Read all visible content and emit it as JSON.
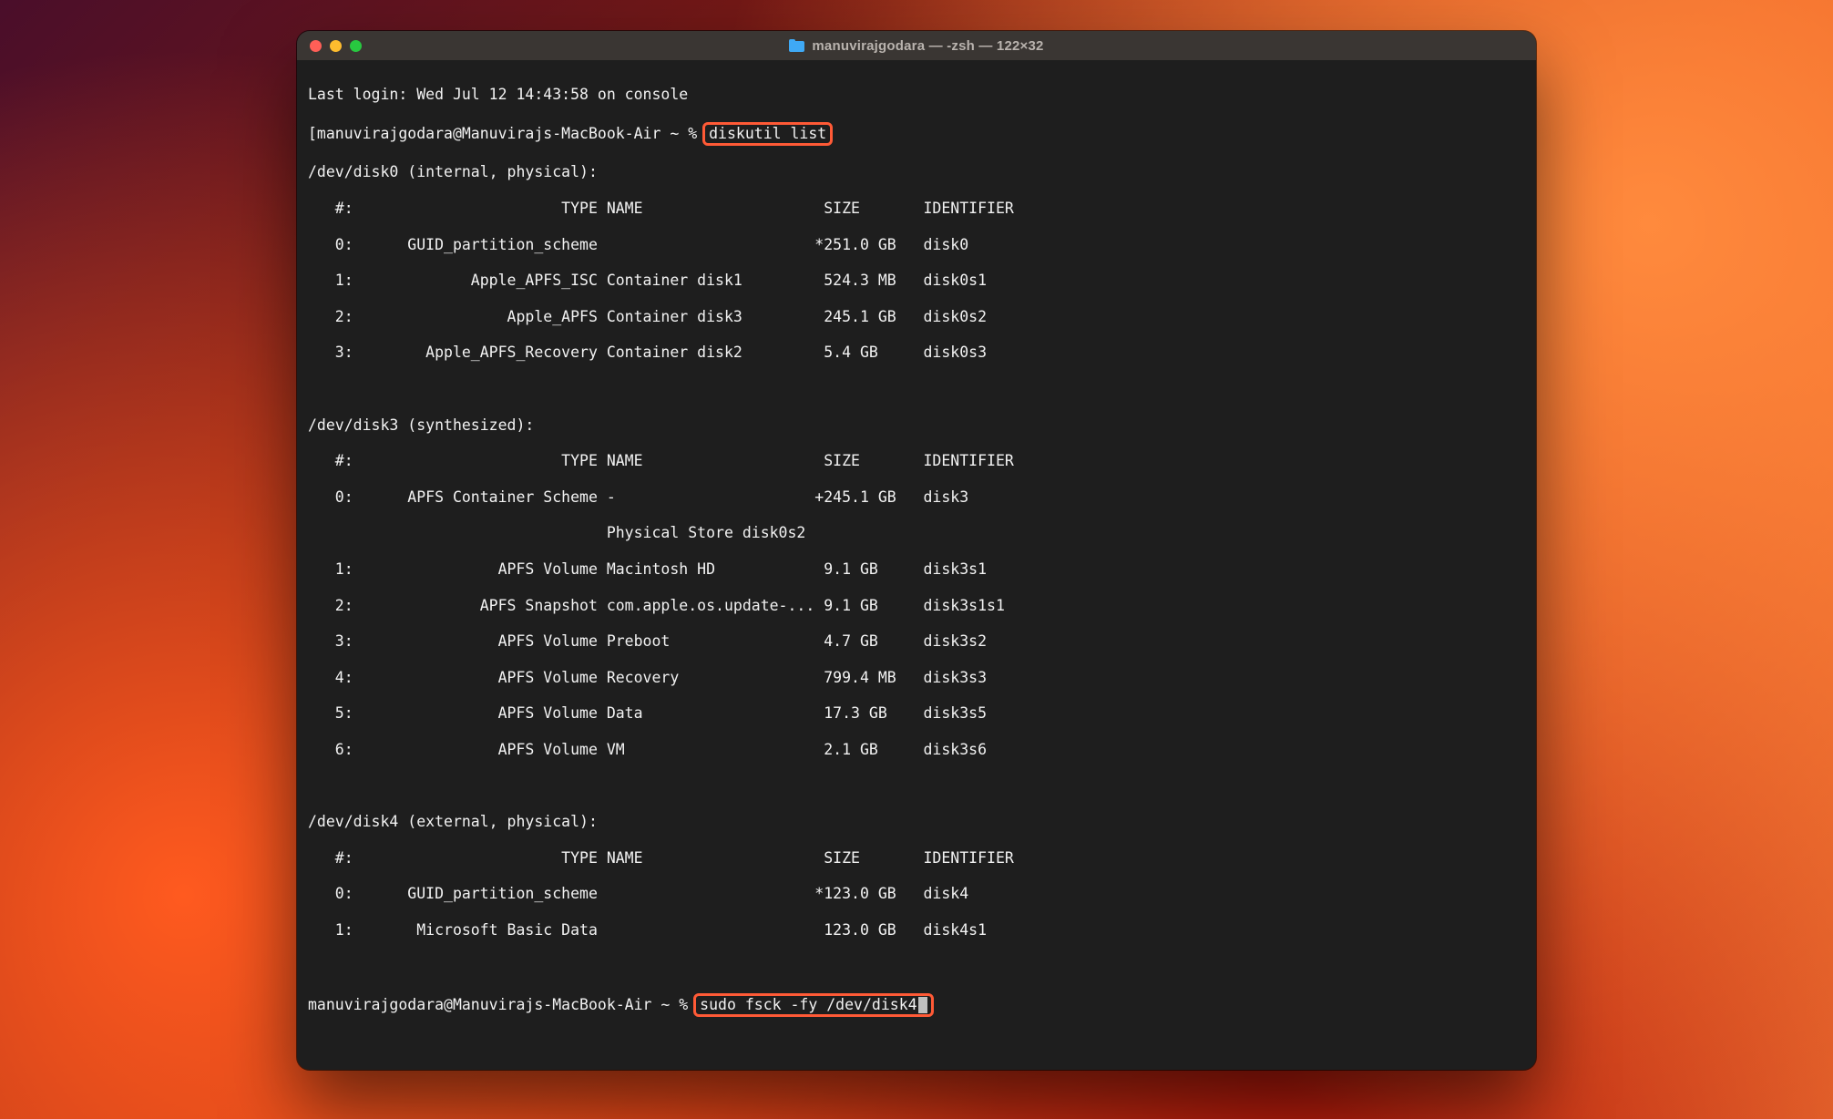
{
  "window": {
    "title": "manuvirajgodara — -zsh — 122×32"
  },
  "lastLogin": "Last login: Wed Jul 12 14:43:58 on console",
  "prompt1_prefix": "[manuvirajgodara@Manuvirajs-MacBook-Air ~ % ",
  "prompt1_cmd": "diskutil list",
  "disks": {
    "disk0": {
      "header": "/dev/disk0 (internal, physical):",
      "cols": "   #:                       TYPE NAME                    SIZE       IDENTIFIER",
      "rows": [
        "   0:      GUID_partition_scheme                        *251.0 GB   disk0",
        "   1:             Apple_APFS_ISC Container disk1         524.3 MB   disk0s1",
        "   2:                 Apple_APFS Container disk3         245.1 GB   disk0s2",
        "   3:        Apple_APFS_Recovery Container disk2         5.4 GB     disk0s3"
      ]
    },
    "disk3": {
      "header": "/dev/disk3 (synthesized):",
      "cols": "   #:                       TYPE NAME                    SIZE       IDENTIFIER",
      "rows": [
        "   0:      APFS Container Scheme -                      +245.1 GB   disk3",
        "                                 Physical Store disk0s2",
        "   1:                APFS Volume Macintosh HD            9.1 GB     disk3s1",
        "   2:              APFS Snapshot com.apple.os.update-... 9.1 GB     disk3s1s1",
        "   3:                APFS Volume Preboot                 4.7 GB     disk3s2",
        "   4:                APFS Volume Recovery                799.4 MB   disk3s3",
        "   5:                APFS Volume Data                    17.3 GB    disk3s5",
        "   6:                APFS Volume VM                      2.1 GB     disk3s6"
      ]
    },
    "disk4": {
      "header": "/dev/disk4 (external, physical):",
      "cols": "   #:                       TYPE NAME                    SIZE       IDENTIFIER",
      "rows": [
        "   0:      GUID_partition_scheme                        *123.0 GB   disk4",
        "   1:       Microsoft Basic Data                         123.0 GB   disk4s1"
      ]
    }
  },
  "prompt2_prefix": "manuvirajgodara@Manuvirajs-MacBook-Air ~ % ",
  "prompt2_cmd": "sudo fsck -fy /dev/disk4"
}
